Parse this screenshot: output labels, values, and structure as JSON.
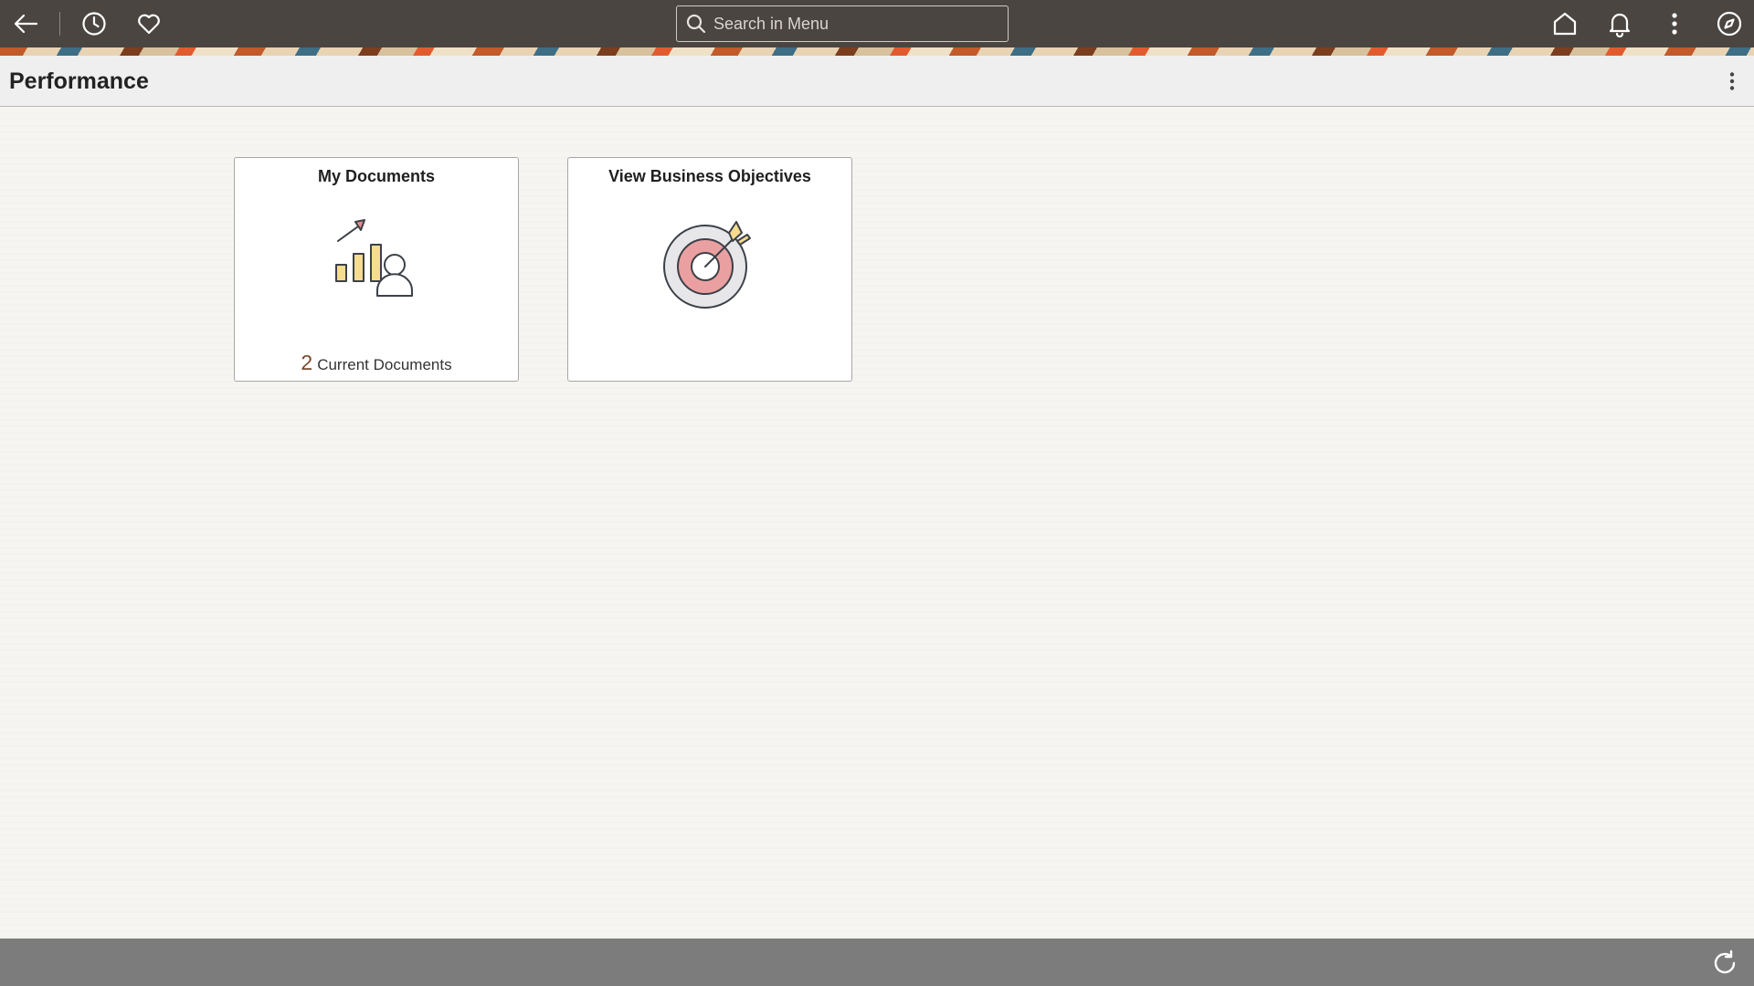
{
  "topbar": {
    "back_icon": "back-arrow-icon",
    "recent_icon": "clock-icon",
    "favorites_icon": "heart-icon",
    "search": {
      "placeholder": "Search in Menu",
      "value": ""
    },
    "home_icon": "home-icon",
    "notifications_icon": "bell-icon",
    "actions_icon": "vertical-dots-icon",
    "navigator_icon": "compass-icon"
  },
  "page": {
    "title": "Performance"
  },
  "tiles": [
    {
      "title": "My Documents",
      "icon": "chart-person-icon",
      "count": "2",
      "count_label": "Current Documents"
    },
    {
      "title": "View Business Objectives",
      "icon": "target-arrow-icon"
    }
  ],
  "colors": {
    "topbar_bg": "#4b4541",
    "page_bg": "#f6f5f2",
    "footer_bg": "#7c7c7c",
    "count_color": "#7a4a2a"
  },
  "footer": {
    "refresh_icon": "refresh-icon"
  }
}
